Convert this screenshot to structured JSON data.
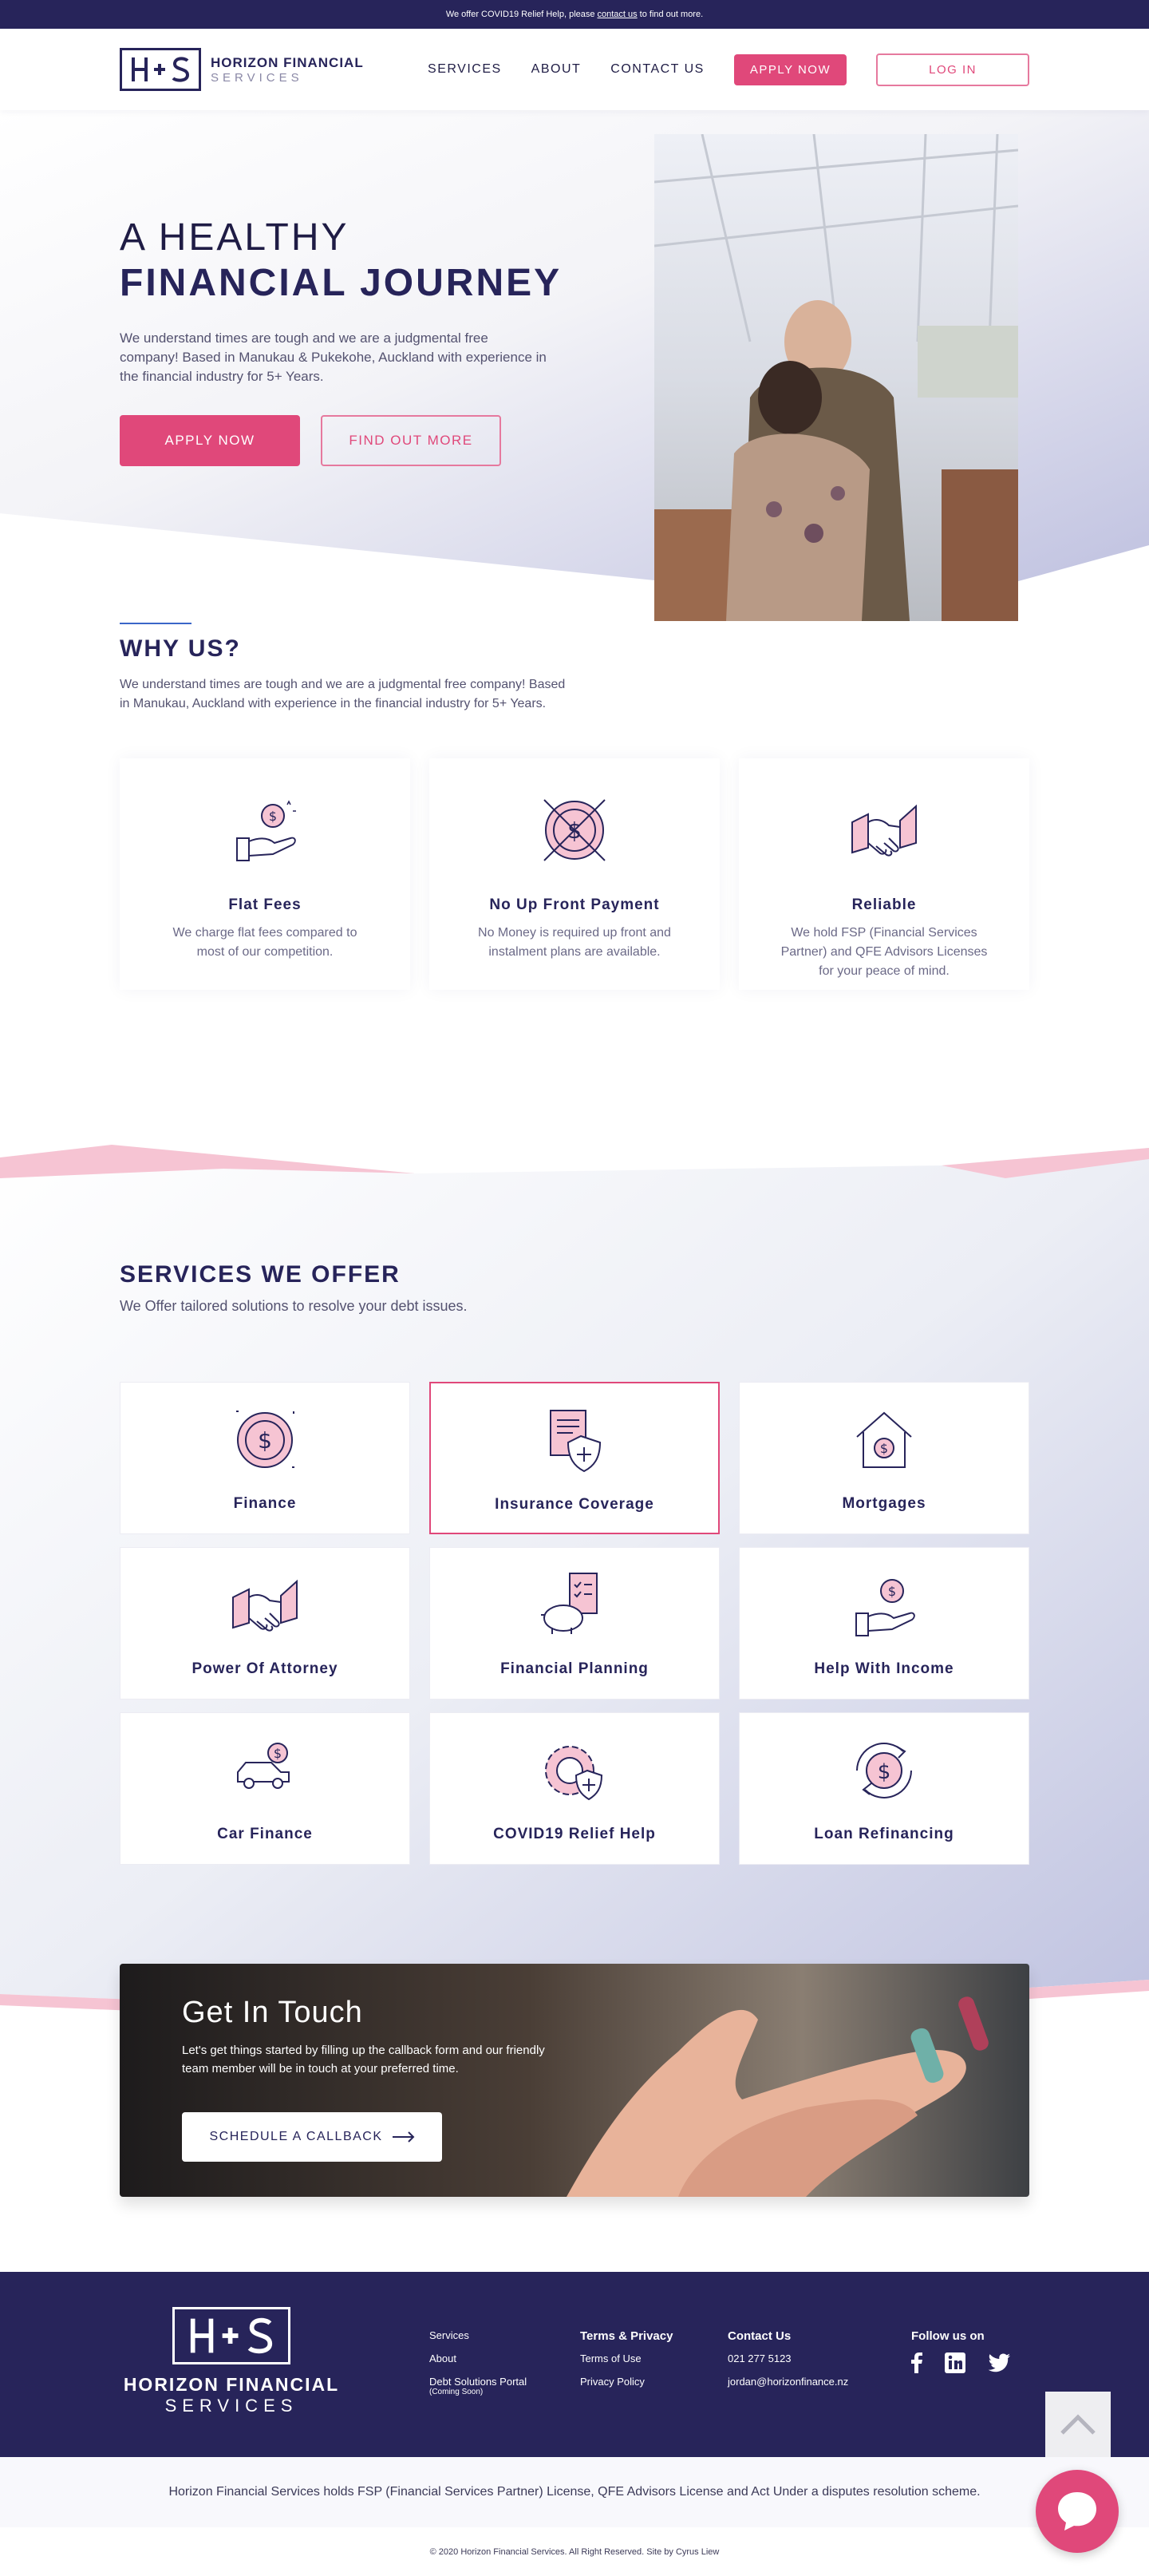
{
  "topbar": {
    "text_before": "We offer COVID19 Relief Help, please",
    "link": "contact us",
    "text_after": "to find out more."
  },
  "brand": {
    "monogram": "H+S",
    "name_line1": "HORIZON FINANCIAL",
    "name_line2": "SERVICES"
  },
  "nav": {
    "items": [
      {
        "label": "SERVICES"
      },
      {
        "label": "ABOUT"
      },
      {
        "label": "CONTACT US"
      }
    ],
    "apply_label": "APPLY NOW",
    "login_label": "LOG IN"
  },
  "hero": {
    "title_line1": "A HEALTHY",
    "title_line2": "FINANCIAL JOURNEY",
    "text": "We understand times are tough and we are a judgmental free company! Based in Manukau & Pukekohe, Auckland with experience in the financial industry for 5+ Years.",
    "apply_label": "APPLY NOW",
    "find_label": "FIND OUT MORE"
  },
  "why": {
    "title": "WHY US?",
    "text": "We understand times are tough and we are a judgmental free company! Based in Manukau, Auckland with experience in the financial industry for 5+ Years.",
    "cards": [
      {
        "icon": "hand-coin-icon",
        "title": "Flat Fees",
        "text": "We charge flat fees compared to most of our competition."
      },
      {
        "icon": "no-dollar-icon",
        "title": "No Up Front Payment",
        "text": "No Money is required up front and instalment plans are available."
      },
      {
        "icon": "handshake-icon",
        "title": "Reliable",
        "text": "We hold FSP (Financial Services Partner) and QFE Advisors Licenses for your peace of mind."
      }
    ]
  },
  "services": {
    "title": "SERVICES WE OFFER",
    "subtitle": "We Offer tailored solutions to resolve your debt issues.",
    "items": [
      {
        "icon": "dollar-coin-icon",
        "label": "Finance"
      },
      {
        "icon": "insurance-shield-icon",
        "label": "Insurance Coverage"
      },
      {
        "icon": "house-dollar-icon",
        "label": "Mortgages"
      },
      {
        "icon": "handshake-icon",
        "label": "Power Of Attorney"
      },
      {
        "icon": "piggy-bank-icon",
        "label": "Financial Planning"
      },
      {
        "icon": "hand-coin-icon",
        "label": "Help With Income"
      },
      {
        "icon": "car-dollar-icon",
        "label": "Car Finance"
      },
      {
        "icon": "gear-shield-icon",
        "label": "COVID19 Relief Help"
      },
      {
        "icon": "refinance-icon",
        "label": "Loan Refinancing"
      }
    ]
  },
  "contact": {
    "title": "Get In Touch",
    "text": "Let's get things started by filling up the callback form and our friendly team member will be in touch at your preferred time.",
    "button_label": "SCHEDULE A CALLBACK"
  },
  "footer": {
    "logo_monogram": "H+S",
    "logo_line1": "HORIZON FINANCIAL",
    "logo_line2": "SERVICES",
    "links": [
      "Services",
      "About",
      "Debt Solutions Portal"
    ],
    "coming_soon": "(Coming Soon)",
    "terms_title": "Terms & Privacy",
    "terms_links": [
      "Terms of Use",
      "Privacy Policy"
    ],
    "contact_title": "Contact Us",
    "phone": "021 277 5123",
    "email": "jordan@horizonfinance.nz",
    "follow_title": "Follow us on",
    "social": [
      "facebook-icon",
      "linkedin-icon",
      "twitter-icon"
    ]
  },
  "legal": "Horizon Financial Services holds FSP (Financial Services Partner) License, QFE Advisors License and Act Under a disputes resolution scheme.",
  "copyright": "© 2020 Horizon Financial Services. All Right Reserved. Site by Cyrus Liew",
  "colors": {
    "navy": "#27245a",
    "pink": "#e0487a",
    "pink_light": "#f6c4d3",
    "lavender": "#c2c4e3"
  }
}
